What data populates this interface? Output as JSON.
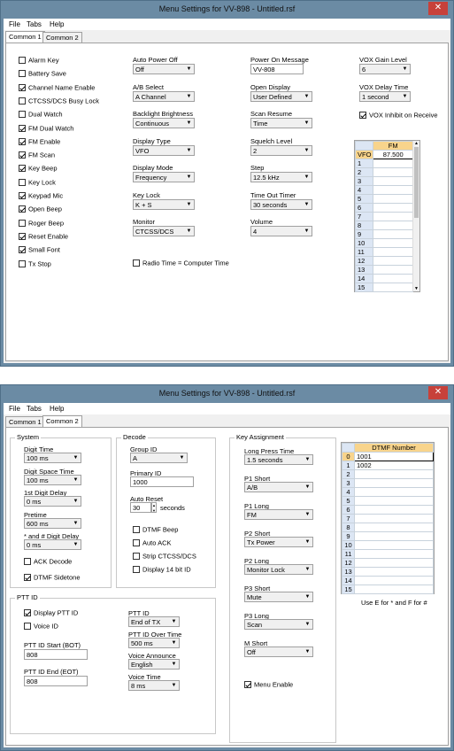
{
  "window1": {
    "title": "Menu Settings for VV-898 - Untitled.rsf",
    "menu": [
      "File",
      "Tabs",
      "Help"
    ],
    "tabs": [
      "Common 1",
      "Common 2"
    ],
    "checkboxes": [
      {
        "label": "Alarm Key",
        "checked": false
      },
      {
        "label": "Battery Save",
        "checked": false
      },
      {
        "label": "Channel Name Enable",
        "checked": true
      },
      {
        "label": "CTCSS/DCS Busy Lock",
        "checked": false
      },
      {
        "label": "Dual Watch",
        "checked": false
      },
      {
        "label": "FM Dual Watch",
        "checked": true
      },
      {
        "label": "FM Enable",
        "checked": true
      },
      {
        "label": "FM Scan",
        "checked": true
      },
      {
        "label": "Key Beep",
        "checked": true
      },
      {
        "label": "Key Lock",
        "checked": false
      },
      {
        "label": "Keypad Mic",
        "checked": true
      },
      {
        "label": "Open Beep",
        "checked": true
      },
      {
        "label": "Roger Beep",
        "checked": false
      },
      {
        "label": "Reset Enable",
        "checked": true
      },
      {
        "label": "Small Font",
        "checked": true
      },
      {
        "label": "Tx Stop",
        "checked": false
      }
    ],
    "col2": [
      {
        "label": "Auto Power Off",
        "value": "Off"
      },
      {
        "label": "A/B Select",
        "value": "A Channel"
      },
      {
        "label": "Backlight Brightness",
        "value": "Continuous"
      },
      {
        "label": "Display Type",
        "value": "VFO"
      },
      {
        "label": "Display Mode",
        "value": "Frequency"
      },
      {
        "label": "Key Lock",
        "value": "K + S"
      },
      {
        "label": "Monitor",
        "value": "CTCSS/DCS"
      }
    ],
    "radio_time": {
      "label": "Radio Time = Computer Time",
      "checked": false
    },
    "col3": [
      {
        "label": "Power On Message",
        "value": "VV-808",
        "text": true
      },
      {
        "label": "Open Display",
        "value": "User Defined"
      },
      {
        "label": "Scan Resume",
        "value": "Time"
      },
      {
        "label": "Squelch Level",
        "value": "2"
      },
      {
        "label": "Step",
        "value": "12.5 kHz"
      },
      {
        "label": "Time Out Timer",
        "value": "30 seconds"
      },
      {
        "label": "Volume",
        "value": "4"
      }
    ],
    "col4": [
      {
        "label": "VOX Gain Level",
        "value": "6"
      },
      {
        "label": "VOX Delay Time",
        "value": "1 second"
      }
    ],
    "vox_inhibit": {
      "label": "VOX Inhibit on Receive",
      "checked": true
    },
    "fm_grid": {
      "header": "FM",
      "rows": [
        {
          "id": "VFO",
          "value": "87.500"
        },
        {
          "id": "1",
          "value": ""
        },
        {
          "id": "2",
          "value": ""
        },
        {
          "id": "3",
          "value": ""
        },
        {
          "id": "4",
          "value": ""
        },
        {
          "id": "5",
          "value": ""
        },
        {
          "id": "6",
          "value": ""
        },
        {
          "id": "7",
          "value": ""
        },
        {
          "id": "8",
          "value": ""
        },
        {
          "id": "9",
          "value": ""
        },
        {
          "id": "10",
          "value": ""
        },
        {
          "id": "11",
          "value": ""
        },
        {
          "id": "12",
          "value": ""
        },
        {
          "id": "13",
          "value": ""
        },
        {
          "id": "14",
          "value": ""
        },
        {
          "id": "15",
          "value": ""
        }
      ]
    }
  },
  "window2": {
    "title": "Menu Settings for VV-898 - Untitled.rsf",
    "menu": [
      "File",
      "Tabs",
      "Help"
    ],
    "tabs": [
      "Common 1",
      "Common 2"
    ],
    "system": {
      "title": "System",
      "fields": [
        {
          "label": "Digit Time",
          "value": "100 ms"
        },
        {
          "label": "Digit Space Time",
          "value": "100 ms"
        },
        {
          "label": "1st Digit Delay",
          "value": "0 ms"
        },
        {
          "label": "Pretime",
          "value": "600 ms"
        },
        {
          "label": "* and # Digit Delay",
          "value": "0 ms"
        }
      ],
      "ack_decode": {
        "label": "ACK Decode",
        "checked": false
      },
      "dtmf_sidetone": {
        "label": "DTMF Sidetone",
        "checked": true
      }
    },
    "decode": {
      "title": "Decode",
      "group_id_label": "Group ID",
      "group_id_value": "A",
      "primary_id_label": "Primary ID",
      "primary_id_value": "1000",
      "auto_reset_label": "Auto Reset",
      "auto_reset_value": "30",
      "auto_reset_unit": "seconds",
      "checks": [
        {
          "label": "DTMF Beep",
          "checked": false
        },
        {
          "label": "Auto ACK",
          "checked": false
        },
        {
          "label": "Strip CTCSS/DCS",
          "checked": false
        },
        {
          "label": "Display 14 bit ID",
          "checked": false
        }
      ]
    },
    "ptt": {
      "title": "PTT ID",
      "display_ptt_id": {
        "label": "Display PTT ID",
        "checked": true
      },
      "voice_id": {
        "label": "Voice ID",
        "checked": false
      },
      "start_label": "PTT ID Start (BOT)",
      "start_value": "808",
      "end_label": "PTT ID End (EOT)",
      "end_value": "808",
      "fields": [
        {
          "label": "PTT ID",
          "value": "End of TX"
        },
        {
          "label": "PTT ID Over Time",
          "value": "500 ms"
        },
        {
          "label": "Voice Announce",
          "value": "English"
        },
        {
          "label": "Voice Time",
          "value": "8 ms"
        }
      ]
    },
    "key_assignment": {
      "title": "Key Assignment",
      "fields": [
        {
          "label": "Long Press Time",
          "value": "1.5 seconds"
        },
        {
          "label": "P1 Short",
          "value": "A/B"
        },
        {
          "label": "P1 Long",
          "value": "FM"
        },
        {
          "label": "P2 Short",
          "value": "Tx Power"
        },
        {
          "label": "P2 Long",
          "value": "Monitor Lock"
        },
        {
          "label": "P3 Short",
          "value": "Mute"
        },
        {
          "label": "P3 Long",
          "value": "Scan"
        },
        {
          "label": "M Short",
          "value": "Off"
        }
      ],
      "menu_enable": {
        "label": "Menu Enable",
        "checked": true
      }
    },
    "dtmf_grid": {
      "header": "DTMF Number",
      "rows": [
        {
          "id": "0",
          "value": "1001"
        },
        {
          "id": "1",
          "value": "1002"
        },
        {
          "id": "2",
          "value": ""
        },
        {
          "id": "3",
          "value": ""
        },
        {
          "id": "4",
          "value": ""
        },
        {
          "id": "5",
          "value": ""
        },
        {
          "id": "6",
          "value": ""
        },
        {
          "id": "7",
          "value": ""
        },
        {
          "id": "8",
          "value": ""
        },
        {
          "id": "9",
          "value": ""
        },
        {
          "id": "10",
          "value": ""
        },
        {
          "id": "11",
          "value": ""
        },
        {
          "id": "12",
          "value": ""
        },
        {
          "id": "13",
          "value": ""
        },
        {
          "id": "14",
          "value": ""
        },
        {
          "id": "15",
          "value": ""
        }
      ],
      "footnote": "Use E for * and F for #"
    }
  }
}
